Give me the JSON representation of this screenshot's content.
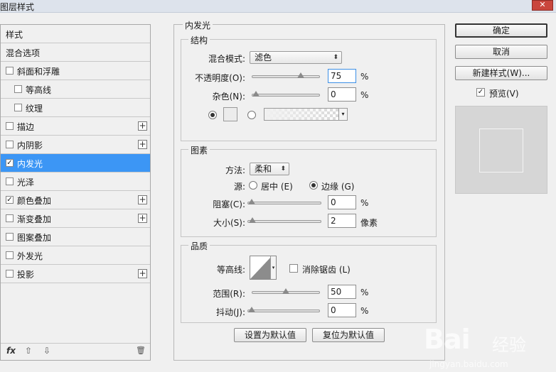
{
  "window": {
    "title": "图层样式",
    "close_label": "✕"
  },
  "styles_list": [
    {
      "label": "样式",
      "checkbox": false,
      "checked": false,
      "plus": false,
      "indent": 0,
      "selected": false
    },
    {
      "label": "混合选项",
      "checkbox": false,
      "checked": false,
      "plus": false,
      "indent": 0,
      "selected": false
    },
    {
      "label": "斜面和浮雕",
      "checkbox": true,
      "checked": false,
      "plus": false,
      "indent": 0,
      "selected": false
    },
    {
      "label": "等高线",
      "checkbox": true,
      "checked": false,
      "plus": false,
      "indent": 1,
      "selected": false
    },
    {
      "label": "纹理",
      "checkbox": true,
      "checked": false,
      "plus": false,
      "indent": 1,
      "selected": false
    },
    {
      "label": "描边",
      "checkbox": true,
      "checked": false,
      "plus": true,
      "indent": 0,
      "selected": false
    },
    {
      "label": "内阴影",
      "checkbox": true,
      "checked": false,
      "plus": true,
      "indent": 0,
      "selected": false
    },
    {
      "label": "内发光",
      "checkbox": true,
      "checked": true,
      "plus": false,
      "indent": 0,
      "selected": true
    },
    {
      "label": "光泽",
      "checkbox": true,
      "checked": false,
      "plus": false,
      "indent": 0,
      "selected": false
    },
    {
      "label": "颜色叠加",
      "checkbox": true,
      "checked": true,
      "plus": true,
      "indent": 0,
      "selected": false
    },
    {
      "label": "渐变叠加",
      "checkbox": true,
      "checked": false,
      "plus": true,
      "indent": 0,
      "selected": false
    },
    {
      "label": "图案叠加",
      "checkbox": true,
      "checked": false,
      "plus": false,
      "indent": 0,
      "selected": false
    },
    {
      "label": "外发光",
      "checkbox": true,
      "checked": false,
      "plus": false,
      "indent": 0,
      "selected": false
    },
    {
      "label": "投影",
      "checkbox": true,
      "checked": false,
      "plus": true,
      "indent": 0,
      "selected": false
    }
  ],
  "footer": {
    "fx": "fx",
    "up": "⇧",
    "down": "⇩",
    "trash": "🗑"
  },
  "panel": {
    "title": "内发光",
    "structure": {
      "title": "结构",
      "blend_mode_label": "混合模式:",
      "blend_mode_value": "滤色",
      "opacity_label": "不透明度(O):",
      "opacity_value": "75",
      "noise_label": "杂色(N):",
      "noise_value": "0",
      "percent": "%",
      "opacity_level": 0.75,
      "noise_level": 0.0
    },
    "elements": {
      "title": "图素",
      "method_label": "方法:",
      "method_value": "柔和",
      "source_label": "源:",
      "center_label": "居中 (E)",
      "edge_label": "边缘 (G)",
      "choke_label": "阻塞(C):",
      "choke_value": "0",
      "size_label": "大小(S):",
      "size_value": "2",
      "percent": "%",
      "pixel_unit": "像素",
      "choke_level": 0.0,
      "size_level": 0.01
    },
    "quality": {
      "title": "品质",
      "contour_label": "等高线:",
      "antialias_label": "消除锯齿 (L)",
      "range_label": "范围(R):",
      "range_value": "50",
      "jitter_label": "抖动(J):",
      "jitter_value": "0",
      "percent": "%",
      "range_level": 0.5,
      "jitter_level": 0.0
    },
    "set_default_label": "设置为默认值",
    "reset_default_label": "复位为默认值"
  },
  "right": {
    "ok_label": "确定",
    "cancel_label": "取消",
    "new_style_label": "新建样式(W)...",
    "preview_label": "预览(V)",
    "preview_checked": true
  },
  "watermark": {
    "brand": "Bai",
    "cn": "经验",
    "url": "jingyan.baidu.com"
  }
}
